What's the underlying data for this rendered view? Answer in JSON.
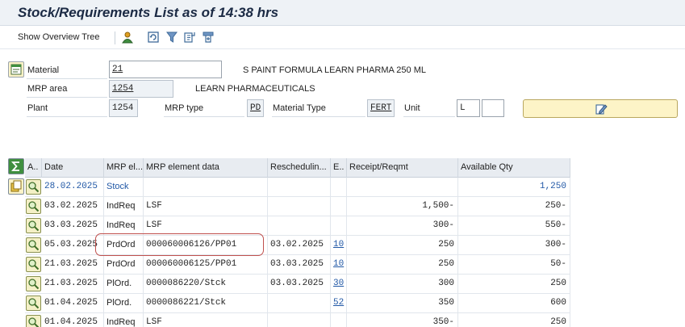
{
  "title": "Stock/Requirements List as of 14:38 hrs",
  "toolbar": {
    "show_overview_tree": "Show Overview Tree"
  },
  "header": {
    "material_label": "Material",
    "material_value": "21",
    "material_desc": "S PAINT FORMULA LEARN PHARMA 250 ML",
    "mrp_area_label": "MRP area",
    "mrp_area_value": "1254",
    "mrp_area_desc": "LEARN PHARMACEUTICALS",
    "plant_label": "Plant",
    "plant_value": "1254",
    "mrp_type_label": "MRP type",
    "mrp_type_value": "PD",
    "material_type_label": "Material Type",
    "material_type_value": "FERT",
    "unit_label": "Unit",
    "unit_value": "L",
    "unit_extra": ""
  },
  "grid": {
    "columns": [
      "A..",
      "Date",
      "MRP el...",
      "MRP element data",
      "Reschedulin...",
      "E..",
      "Receipt/Reqmt",
      "Available Qty"
    ],
    "rows": [
      {
        "date": "28.02.2025",
        "mrp_el": "Stock",
        "data": "",
        "resched": "",
        "e": "",
        "receipt": "",
        "avail": "1,250",
        "blue": true
      },
      {
        "date": "03.02.2025",
        "mrp_el": "IndReq",
        "data": "LSF",
        "resched": "",
        "e": "",
        "receipt": "1,500-",
        "avail": "250-",
        "blue": false
      },
      {
        "date": "03.03.2025",
        "mrp_el": "IndReq",
        "data": "LSF",
        "resched": "",
        "e": "",
        "receipt": "300-",
        "avail": "550-",
        "blue": false
      },
      {
        "date": "05.03.2025",
        "mrp_el": "PrdOrd",
        "data": "000060006126/PP01",
        "resched": "03.02.2025",
        "e": "10",
        "receipt": "250",
        "avail": "300-",
        "blue": false
      },
      {
        "date": "21.03.2025",
        "mrp_el": "PrdOrd",
        "data": "000060006125/PP01",
        "resched": "03.03.2025",
        "e": "10",
        "receipt": "250",
        "avail": "50-",
        "blue": false
      },
      {
        "date": "21.03.2025",
        "mrp_el": "PlOrd.",
        "data": "0000086220/Stck",
        "resched": "03.03.2025",
        "e": "30",
        "receipt": "300",
        "avail": "250",
        "blue": false
      },
      {
        "date": "01.04.2025",
        "mrp_el": "PlOrd.",
        "data": "0000086221/Stck",
        "resched": "",
        "e": "52",
        "receipt": "350",
        "avail": "600",
        "blue": false
      },
      {
        "date": "01.04.2025",
        "mrp_el": "IndReq",
        "data": "LSF",
        "resched": "",
        "e": "",
        "receipt": "350-",
        "avail": "250",
        "blue": false
      }
    ]
  },
  "colors": {
    "highlight": "#c0504d",
    "link": "#2158a6"
  }
}
